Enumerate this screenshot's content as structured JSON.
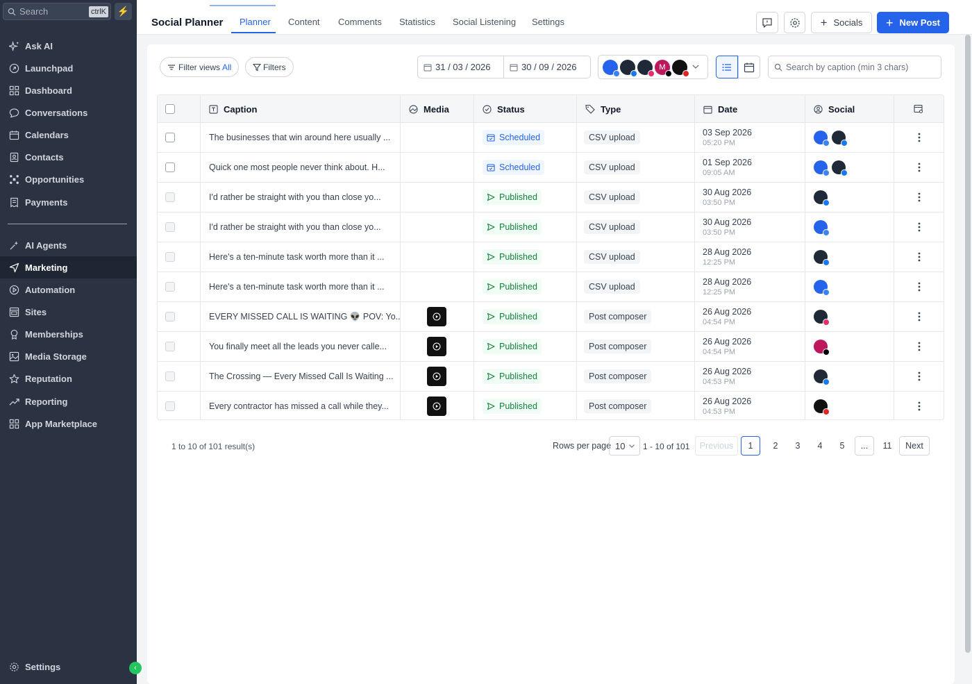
{
  "sidebar": {
    "search_placeholder": "Search",
    "search_shortcut": "ctrlK",
    "items": [
      {
        "label": "Ask AI",
        "icon": "sparkle-icon"
      },
      {
        "label": "Launchpad",
        "icon": "rocket-icon"
      },
      {
        "label": "Dashboard",
        "icon": "grid-icon"
      },
      {
        "label": "Conversations",
        "icon": "chat-icon"
      },
      {
        "label": "Calendars",
        "icon": "calendar-icon"
      },
      {
        "label": "Contacts",
        "icon": "contacts-icon"
      },
      {
        "label": "Opportunities",
        "icon": "funnel-icon"
      },
      {
        "label": "Payments",
        "icon": "receipt-icon"
      },
      {
        "label": "AI Agents",
        "icon": "agent-icon"
      },
      {
        "label": "Marketing",
        "icon": "send-icon"
      },
      {
        "label": "Automation",
        "icon": "automation-icon"
      },
      {
        "label": "Sites",
        "icon": "sites-icon"
      },
      {
        "label": "Memberships",
        "icon": "membership-icon"
      },
      {
        "label": "Media Storage",
        "icon": "image-icon"
      },
      {
        "label": "Reputation",
        "icon": "star-icon"
      },
      {
        "label": "Reporting",
        "icon": "chart-icon"
      },
      {
        "label": "App Marketplace",
        "icon": "apps-icon"
      }
    ],
    "active": "Marketing",
    "settings_label": "Settings"
  },
  "topbar": {
    "title": "Social Planner",
    "tabs": [
      "Planner",
      "Content",
      "Comments",
      "Statistics",
      "Social Listening",
      "Settings"
    ],
    "active_tab": "Planner",
    "socials_label": "Socials",
    "new_post_label": "New Post"
  },
  "toolbar": {
    "filter_views_label": "Filter views",
    "filter_views_value": "All",
    "filters_label": "Filters",
    "date_from": "31 / 03 / 2026",
    "date_to": "30 / 09 / 2026",
    "search_placeholder": "Search by caption (min 3 chars)"
  },
  "table": {
    "headers": {
      "caption": "Caption",
      "media": "Media",
      "status": "Status",
      "type": "Type",
      "date": "Date",
      "social": "Social"
    },
    "rows": [
      {
        "caption": "The businesses that win around here usually ...",
        "media": false,
        "status": "Scheduled",
        "type": "CSV upload",
        "date": "03 Sep 2026",
        "time": "05:20 PM",
        "socials": [
          "gbp",
          "fb"
        ]
      },
      {
        "caption": "Quick one most people never think about. H...",
        "media": false,
        "status": "Scheduled",
        "type": "CSV upload",
        "date": "01 Sep 2026",
        "time": "09:05 AM",
        "socials": [
          "gbp",
          "fb"
        ]
      },
      {
        "caption": "I'd rather be straight with you than close yo...",
        "media": false,
        "status": "Published",
        "type": "CSV upload",
        "date": "30 Aug 2026",
        "time": "03:50 PM",
        "socials": [
          "fb"
        ]
      },
      {
        "caption": "I'd rather be straight with you than close yo...",
        "media": false,
        "status": "Published",
        "type": "CSV upload",
        "date": "30 Aug 2026",
        "time": "03:50 PM",
        "socials": [
          "gbp"
        ]
      },
      {
        "caption": "Here's a ten-minute task worth more than it ...",
        "media": false,
        "status": "Published",
        "type": "CSV upload",
        "date": "28 Aug 2026",
        "time": "12:25 PM",
        "socials": [
          "fb"
        ]
      },
      {
        "caption": "Here's a ten-minute task worth more than it ...",
        "media": false,
        "status": "Published",
        "type": "CSV upload",
        "date": "28 Aug 2026",
        "time": "12:25 PM",
        "socials": [
          "gbp"
        ]
      },
      {
        "caption": "EVERY MISSED CALL IS WAITING 👽 POV: Yo...",
        "media": true,
        "status": "Published",
        "type": "Post composer",
        "date": "26 Aug 2026",
        "time": "04:54 PM",
        "socials": [
          "ig"
        ]
      },
      {
        "caption": "You finally meet all the leads you never calle...",
        "media": true,
        "status": "Published",
        "type": "Post composer",
        "date": "26 Aug 2026",
        "time": "04:54 PM",
        "socials": [
          "tiktok"
        ]
      },
      {
        "caption": "The Crossing — Every Missed Call Is Waiting ...",
        "media": true,
        "status": "Published",
        "type": "Post composer",
        "date": "26 Aug 2026",
        "time": "04:53 PM",
        "socials": [
          "fb"
        ]
      },
      {
        "caption": "Every contractor has missed a call while they...",
        "media": true,
        "status": "Published",
        "type": "Post composer",
        "date": "26 Aug 2026",
        "time": "04:53 PM",
        "socials": [
          "yt"
        ]
      }
    ]
  },
  "pagination": {
    "results_text": "1 to 10 of 101 result(s)",
    "rows_per_page_label": "Rows per page",
    "rows_per_page": "10",
    "range_text": "1 - 10 of 101",
    "previous_label": "Previous",
    "pages": [
      "1",
      "2",
      "3",
      "4",
      "5",
      "...",
      "11"
    ],
    "current_page": "1",
    "next_label": "Next"
  },
  "colors": {
    "primary": "#2563eb",
    "sidebar_bg": "#2b3343",
    "published": "#15803d",
    "scheduled": "#2563eb"
  }
}
